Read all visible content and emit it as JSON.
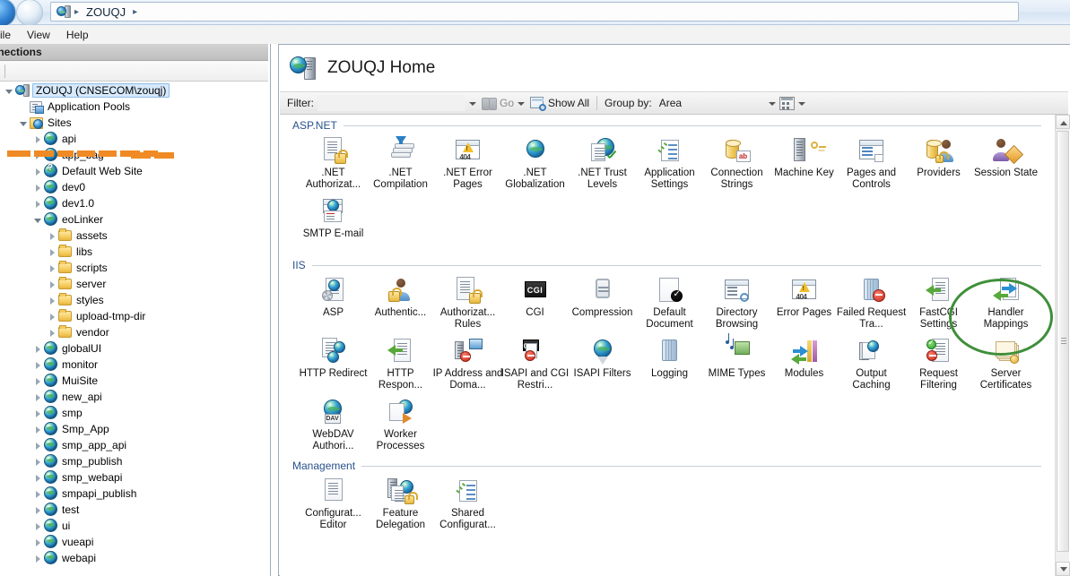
{
  "titlebar": {
    "breadcrumb": [
      "ZOUQJ"
    ],
    "server_icon": "server-icon",
    "sep": "▸"
  },
  "menubar": {
    "items": [
      {
        "label": "ile",
        "name": "menu-file"
      },
      {
        "label": "View",
        "name": "menu-view"
      },
      {
        "label": "Help",
        "name": "menu-help"
      }
    ]
  },
  "connections": {
    "header": "nnections",
    "tree": [
      {
        "label": "ZOUQJ (CNSECOM\\zouqj)",
        "icon": "server-icon",
        "indent": 0,
        "twisty": "open",
        "selected": true
      },
      {
        "label": "Application Pools",
        "icon": "app-pools-icon",
        "indent": 1,
        "twisty": "none",
        "selected": false
      },
      {
        "label": "Sites",
        "icon": "sites-folder-icon",
        "indent": 1,
        "twisty": "open",
        "selected": false
      },
      {
        "label": "api",
        "icon": "website-icon",
        "indent": 2,
        "twisty": "closed",
        "selected": false
      },
      {
        "label": "app_bag",
        "icon": "website-icon",
        "indent": 2,
        "twisty": "closed",
        "selected": false
      },
      {
        "label": "Default Web Site",
        "icon": "website-stopped-icon",
        "indent": 2,
        "twisty": "closed",
        "selected": false
      },
      {
        "label": "dev0",
        "icon": "website-icon",
        "indent": 2,
        "twisty": "closed",
        "selected": false
      },
      {
        "label": "dev1.0",
        "icon": "website-icon",
        "indent": 2,
        "twisty": "closed",
        "selected": false
      },
      {
        "label": "eoLinker",
        "icon": "website-icon",
        "indent": 2,
        "twisty": "open",
        "selected": false
      },
      {
        "label": "assets",
        "icon": "folder-icon",
        "indent": 3,
        "twisty": "closed",
        "selected": false
      },
      {
        "label": "libs",
        "icon": "folder-icon",
        "indent": 3,
        "twisty": "closed",
        "selected": false
      },
      {
        "label": "scripts",
        "icon": "folder-icon",
        "indent": 3,
        "twisty": "closed",
        "selected": false
      },
      {
        "label": "server",
        "icon": "folder-icon",
        "indent": 3,
        "twisty": "closed",
        "selected": false
      },
      {
        "label": "styles",
        "icon": "folder-icon",
        "indent": 3,
        "twisty": "closed",
        "selected": false
      },
      {
        "label": "upload-tmp-dir",
        "icon": "folder-icon",
        "indent": 3,
        "twisty": "closed",
        "selected": false
      },
      {
        "label": "vendor",
        "icon": "folder-icon",
        "indent": 3,
        "twisty": "closed",
        "selected": false
      },
      {
        "label": "globalUI",
        "icon": "website-icon",
        "indent": 2,
        "twisty": "closed",
        "selected": false
      },
      {
        "label": "monitor",
        "icon": "website-icon",
        "indent": 2,
        "twisty": "closed",
        "selected": false
      },
      {
        "label": "MuiSite",
        "icon": "website-icon",
        "indent": 2,
        "twisty": "closed",
        "selected": false
      },
      {
        "label": "new_api",
        "icon": "website-icon",
        "indent": 2,
        "twisty": "closed",
        "selected": false
      },
      {
        "label": "smp",
        "icon": "website-icon",
        "indent": 2,
        "twisty": "closed",
        "selected": false
      },
      {
        "label": "Smp_App",
        "icon": "website-icon",
        "indent": 2,
        "twisty": "closed",
        "selected": false
      },
      {
        "label": "smp_app_api",
        "icon": "website-icon",
        "indent": 2,
        "twisty": "closed",
        "selected": false
      },
      {
        "label": "smp_publish",
        "icon": "website-icon",
        "indent": 2,
        "twisty": "closed",
        "selected": false
      },
      {
        "label": "smp_webapi",
        "icon": "website-icon",
        "indent": 2,
        "twisty": "closed",
        "selected": false
      },
      {
        "label": "smpapi_publish",
        "icon": "website-icon",
        "indent": 2,
        "twisty": "closed",
        "selected": false
      },
      {
        "label": "test",
        "icon": "website-icon",
        "indent": 2,
        "twisty": "closed",
        "selected": false
      },
      {
        "label": "ui",
        "icon": "website-icon",
        "indent": 2,
        "twisty": "closed",
        "selected": false
      },
      {
        "label": "vueapi",
        "icon": "website-icon",
        "indent": 2,
        "twisty": "closed",
        "selected": false
      },
      {
        "label": "webapi",
        "icon": "website-icon",
        "indent": 2,
        "twisty": "closed",
        "selected": false
      }
    ]
  },
  "page": {
    "title": "ZOUQJ Home",
    "icon": "server-home-icon"
  },
  "toolbar": {
    "filter_label": "Filter:",
    "filter_value": "",
    "filter_placeholder": "",
    "go_label": "Go",
    "show_all_label": "Show All",
    "group_by_label": "Group by:",
    "group_by_value": "Area"
  },
  "sections": [
    {
      "title": "ASP.NET",
      "name": "section-aspnet",
      "tiles": [
        {
          "label": ".NET Authorizat...",
          "icon": "net-authorization-rules-icon"
        },
        {
          "label": ".NET Compilation",
          "icon": "net-compilation-icon"
        },
        {
          "label": ".NET Error Pages",
          "icon": "net-error-pages-icon"
        },
        {
          "label": ".NET Globalization",
          "icon": "net-globalization-icon"
        },
        {
          "label": ".NET Trust Levels",
          "icon": "net-trust-levels-icon"
        },
        {
          "label": "Application Settings",
          "icon": "application-settings-icon"
        },
        {
          "label": "Connection Strings",
          "icon": "connection-strings-icon"
        },
        {
          "label": "Machine Key",
          "icon": "machine-key-icon"
        },
        {
          "label": "Pages and Controls",
          "icon": "pages-and-controls-icon"
        },
        {
          "label": "Providers",
          "icon": "providers-icon"
        },
        {
          "label": "Session State",
          "icon": "session-state-icon"
        },
        {
          "label": "SMTP E-mail",
          "icon": "smtp-email-icon"
        }
      ]
    },
    {
      "title": "IIS",
      "name": "section-iis",
      "tiles": [
        {
          "label": "ASP",
          "icon": "asp-icon"
        },
        {
          "label": "Authentic...",
          "icon": "authentication-icon"
        },
        {
          "label": "Authorizat... Rules",
          "icon": "authorization-rules-icon"
        },
        {
          "label": "CGI",
          "icon": "cgi-icon"
        },
        {
          "label": "Compression",
          "icon": "compression-icon"
        },
        {
          "label": "Default Document",
          "icon": "default-document-icon"
        },
        {
          "label": "Directory Browsing",
          "icon": "directory-browsing-icon"
        },
        {
          "label": "Error Pages",
          "icon": "error-pages-icon"
        },
        {
          "label": "Failed Request Tra...",
          "icon": "failed-request-tracing-icon"
        },
        {
          "label": "FastCGI Settings",
          "icon": "fastcgi-settings-icon"
        },
        {
          "label": "Handler Mappings",
          "icon": "handler-mappings-icon",
          "highlighted": true
        },
        {
          "label": "HTTP Redirect",
          "icon": "http-redirect-icon"
        },
        {
          "label": "HTTP Respon...",
          "icon": "http-response-headers-icon"
        },
        {
          "label": "IP Address and Doma...",
          "icon": "ip-address-restrictions-icon"
        },
        {
          "label": "ISAPI and CGI Restri...",
          "icon": "isapi-cgi-restrictions-icon"
        },
        {
          "label": "ISAPI Filters",
          "icon": "isapi-filters-icon"
        },
        {
          "label": "Logging",
          "icon": "logging-icon"
        },
        {
          "label": "MIME Types",
          "icon": "mime-types-icon"
        },
        {
          "label": "Modules",
          "icon": "modules-icon"
        },
        {
          "label": "Output Caching",
          "icon": "output-caching-icon"
        },
        {
          "label": "Request Filtering",
          "icon": "request-filtering-icon"
        },
        {
          "label": "Server Certificates",
          "icon": "server-certificates-icon"
        },
        {
          "label": "WebDAV Authori...",
          "icon": "webdav-authoring-rules-icon"
        },
        {
          "label": "Worker Processes",
          "icon": "worker-processes-icon"
        }
      ]
    },
    {
      "title": "Management",
      "name": "section-management",
      "tiles": [
        {
          "label": "Configurat... Editor",
          "icon": "configuration-editor-icon"
        },
        {
          "label": "Feature Delegation",
          "icon": "feature-delegation-icon"
        },
        {
          "label": "Shared Configurat...",
          "icon": "shared-configuration-icon"
        }
      ]
    }
  ],
  "colors": {
    "section_heading": "#28518c",
    "highlight_ellipse": "#3f8f3a",
    "redaction": "#f08a24",
    "selection": "#d6e9fb"
  }
}
